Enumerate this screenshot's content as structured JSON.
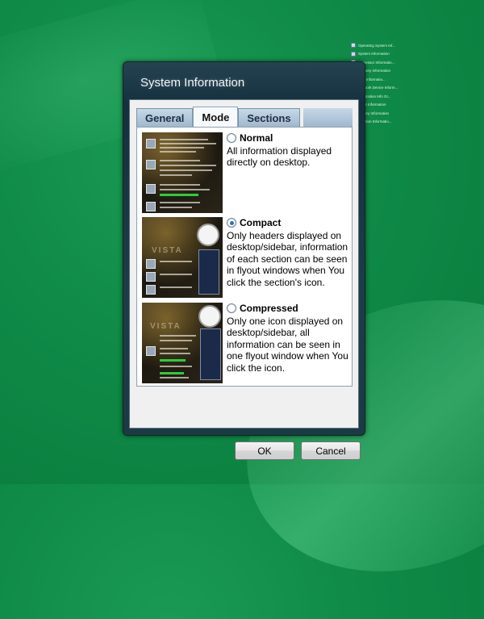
{
  "desktop": {
    "sidebar_items": [
      "Operating System Inf...",
      "System Information",
      "Processor Informatio...",
      "Memory Information",
      "Disk Informatio...",
      "Network Device Inform...",
      "Application Info Gr...",
      "BIOS Information",
      "Battery Information",
      "Partition Informatio..."
    ]
  },
  "dialog": {
    "title": "System Information",
    "tabs": [
      {
        "label": "General",
        "active": false
      },
      {
        "label": "Mode",
        "active": true
      },
      {
        "label": "Sections",
        "active": false
      }
    ],
    "modes": [
      {
        "label": "Normal",
        "selected": false,
        "description": "All information displayed directly on desktop."
      },
      {
        "label": "Compact",
        "selected": true,
        "description": "Only headers displayed on desktop/sidebar, information of each section can be seen in flyout windows when You click the section's icon."
      },
      {
        "label": "Compressed",
        "selected": false,
        "description": "Only one icon displayed on desktop/sidebar, all information can be seen in one flyout window when You click the icon."
      }
    ],
    "ok_label": "OK",
    "cancel_label": "Cancel"
  },
  "colors": {
    "desktop": "#109048",
    "dialog_frame": "#1b3a45",
    "radio_selected": "#2f6fbf"
  }
}
